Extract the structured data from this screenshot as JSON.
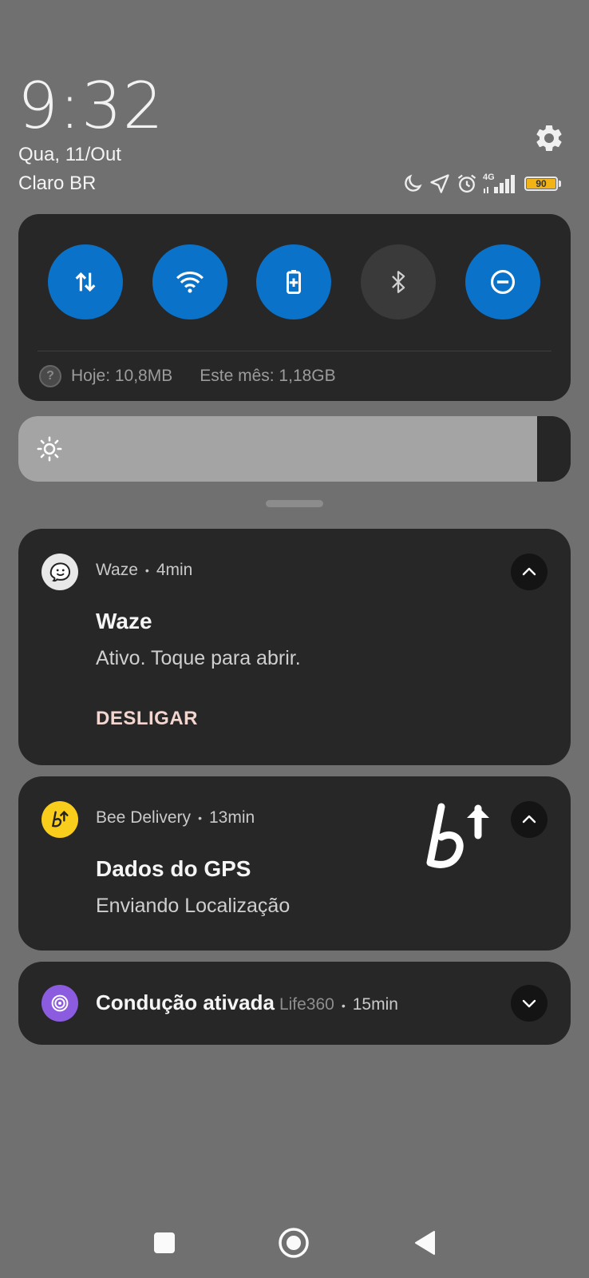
{
  "lockscreen": {
    "time": "9:32",
    "date": "Qua, 11/Out",
    "carrier": "Claro BR"
  },
  "status_bar": {
    "icons": [
      "moon-icon",
      "location-arrow-icon",
      "alarm-icon",
      "signal-4g-icon",
      "battery-icon"
    ],
    "network_type": "4G",
    "battery_level": "90"
  },
  "quick_settings": {
    "tiles": [
      {
        "name": "mobile-data",
        "icon": "data-arrows-icon",
        "state": "on"
      },
      {
        "name": "wifi",
        "icon": "wifi-icon",
        "state": "on"
      },
      {
        "name": "battery-saver",
        "icon": "battery-plus-icon",
        "state": "on"
      },
      {
        "name": "bluetooth",
        "icon": "bluetooth-icon",
        "state": "off"
      },
      {
        "name": "do-not-disturb",
        "icon": "minus-circle-icon",
        "state": "on"
      }
    ],
    "data_today": "Hoje: 10,8MB",
    "data_month": "Este mês: 1,18GB"
  },
  "brightness": {
    "level": 0.94
  },
  "notifications": [
    {
      "app": "Waze",
      "time": "4min",
      "title": "Waze",
      "text": "Ativo. Toque para abrir.",
      "action": "DESLIGAR",
      "expanded": true
    },
    {
      "app": "Bee Delivery",
      "time": "13min",
      "title": "Dados do GPS",
      "text": "Enviando Localização",
      "expanded": true
    },
    {
      "app": "Life360",
      "time": "15min",
      "title": "Condução ativada",
      "expanded": false
    }
  ],
  "colors": {
    "background": "#707070",
    "card": "#272727",
    "accent_blue": "#0a72c8",
    "bee_yellow": "#f9cd1b",
    "life360_purple": "#8c5ce0"
  }
}
